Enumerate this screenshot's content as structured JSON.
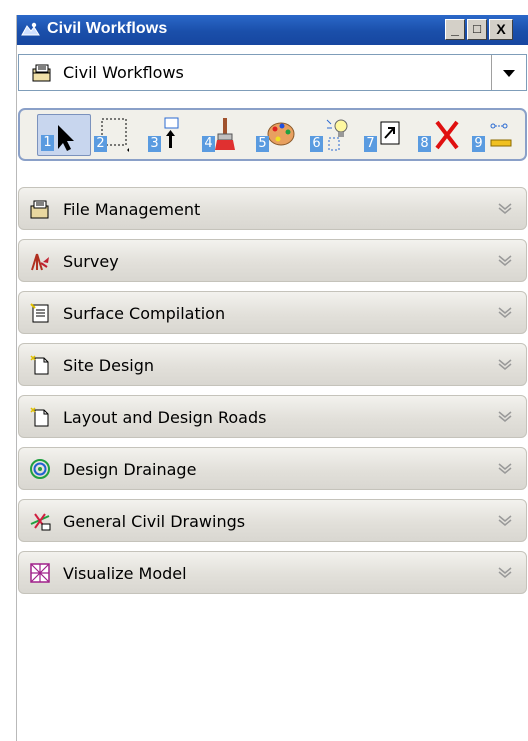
{
  "window": {
    "title": "Civil Workflows"
  },
  "titlebar": {
    "minimize": "_",
    "maximize": "□",
    "close": "X"
  },
  "workflow_select": {
    "value": "Civil Workflows"
  },
  "toolbar": {
    "tools": [
      {
        "number": "1",
        "icon": "select-arrow-icon"
      },
      {
        "number": "2",
        "icon": "marquee-select-icon"
      },
      {
        "number": "3",
        "icon": "move-up-icon"
      },
      {
        "number": "4",
        "icon": "paintbrush-icon"
      },
      {
        "number": "5",
        "icon": "palette-icon"
      },
      {
        "number": "6",
        "icon": "lightbulb-icon"
      },
      {
        "number": "7",
        "icon": "scale-arrow-icon"
      },
      {
        "number": "8",
        "icon": "delete-x-icon"
      },
      {
        "number": "9",
        "icon": "measure-icon"
      }
    ]
  },
  "groups": [
    {
      "label": "File Management",
      "icon": "file-management-icon"
    },
    {
      "label": "Survey",
      "icon": "survey-icon"
    },
    {
      "label": "Surface Compilation",
      "icon": "surface-compilation-icon"
    },
    {
      "label": "Site Design",
      "icon": "site-design-icon"
    },
    {
      "label": "Layout and Design Roads",
      "icon": "layout-roads-icon"
    },
    {
      "label": "Design Drainage",
      "icon": "drainage-icon"
    },
    {
      "label": "General Civil Drawings",
      "icon": "civil-drawings-icon"
    },
    {
      "label": "Visualize Model",
      "icon": "visualize-model-icon"
    }
  ],
  "colors": {
    "titlebar": "#1a4faa",
    "selected_tool": "#c8d6ee",
    "number_badge": "#5a9be0"
  }
}
